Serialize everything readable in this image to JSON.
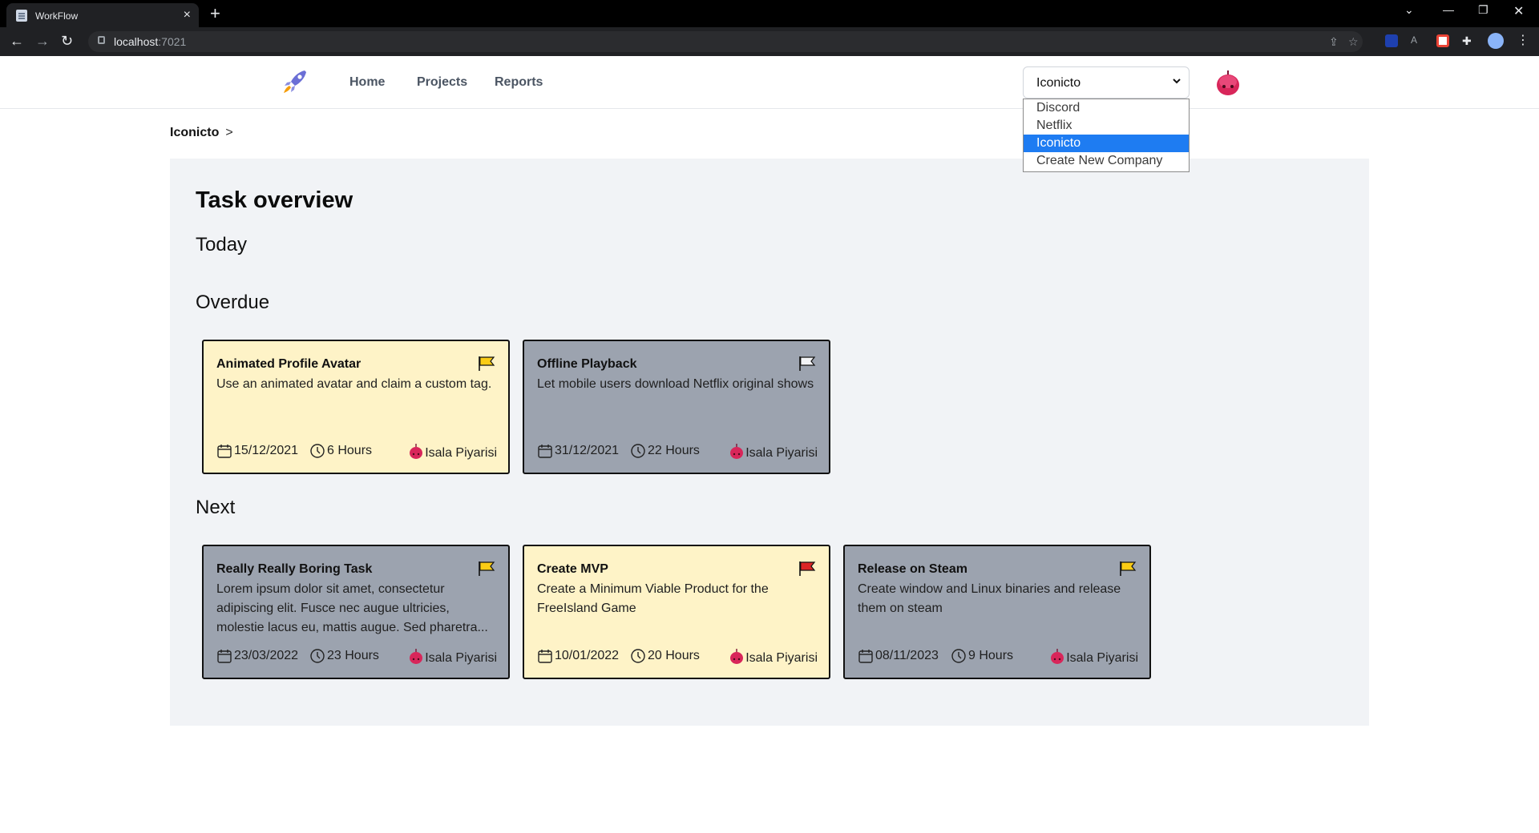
{
  "browser": {
    "tab_title": "WorkFlow",
    "url_host": "localhost",
    "url_port": ":7021"
  },
  "header": {
    "nav": [
      "Home",
      "Projects",
      "Reports"
    ],
    "company_selected": "Iconicto",
    "company_options": [
      "Discord",
      "Netflix",
      "Iconicto",
      "Create New Company"
    ]
  },
  "breadcrumb": {
    "current": "Iconicto",
    "separator": ">"
  },
  "main": {
    "title": "Task overview",
    "sections": {
      "today": "Today",
      "overdue": "Overdue",
      "next": "Next"
    },
    "overdue_tasks": [
      {
        "title": "Animated Profile Avatar",
        "description": "Use an animated avatar and claim a custom tag.",
        "date": "15/12/2021",
        "hours": "6 Hours",
        "assignee": "Isala Piyarisi",
        "flag_color": "#facc15",
        "card_color": "yellow"
      },
      {
        "title": "Offline Playback",
        "description": "Let mobile users download Netflix original shows",
        "date": "31/12/2021",
        "hours": "22 Hours",
        "assignee": "Isala Piyarisi",
        "flag_color": "#f3f4f6",
        "card_color": "grey"
      }
    ],
    "next_tasks": [
      {
        "title": "Really Really Boring Task",
        "description": "Lorem ipsum dolor sit amet, consectetur adipiscing elit. Fusce nec augue ultricies, molestie lacus eu, mattis augue. Sed pharetra...",
        "date": "23/03/2022",
        "hours": "23 Hours",
        "assignee": "Isala Piyarisi",
        "flag_color": "#facc15",
        "card_color": "grey"
      },
      {
        "title": "Create MVP",
        "description": "Create a Minimum Viable Product for the FreeIsland Game",
        "date": "10/01/2022",
        "hours": "20 Hours",
        "assignee": "Isala Piyarisi",
        "flag_color": "#dc2626",
        "card_color": "yellow"
      },
      {
        "title": "Release on Steam",
        "description": "Create window and Linux binaries and release them on steam",
        "date": "08/11/2023",
        "hours": "9 Hours",
        "assignee": "Isala Piyarisi",
        "flag_color": "#facc15",
        "card_color": "grey"
      }
    ]
  },
  "colors": {
    "yellow_card": "#fef3c7",
    "grey_card": "#9ca3af",
    "selected_option": "#1e7cf2",
    "panel_bg": "#f1f3f6"
  }
}
